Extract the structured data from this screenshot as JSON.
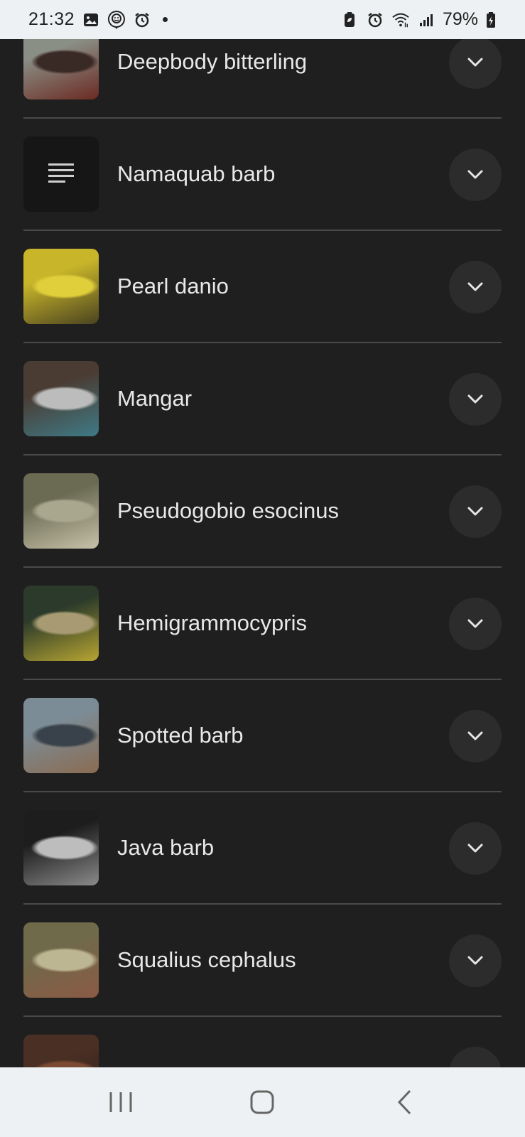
{
  "status_bar": {
    "time": "21:32",
    "battery": "79%",
    "left_icons": [
      "gallery-icon",
      "face-app-icon",
      "alarm-icon"
    ],
    "right_icons": [
      "battery-saver-icon",
      "alarm-icon",
      "wifi-icon",
      "signal-icon",
      "battery-icon"
    ]
  },
  "fish_list": [
    {
      "name": "Deepbody bitterling",
      "thumb": "photo",
      "colors": [
        "#8a8f86",
        "#3a2a26",
        "#6b2a22"
      ]
    },
    {
      "name": "Namaquab barb",
      "thumb": "placeholder",
      "icon": "notes-icon"
    },
    {
      "name": "Pearl danio",
      "thumb": "photo",
      "colors": [
        "#c8b52a",
        "#e0cf3a",
        "#4a4320"
      ]
    },
    {
      "name": "Mangar",
      "thumb": "photo",
      "colors": [
        "#4a3c33",
        "#bcbcbc",
        "#3f7a86"
      ]
    },
    {
      "name": "Pseudogobio esocinus",
      "thumb": "photo",
      "colors": [
        "#6b6b53",
        "#a9a88f",
        "#c7c1a9"
      ]
    },
    {
      "name": "Hemigrammocypris",
      "thumb": "photo",
      "colors": [
        "#2b3a2a",
        "#a89b73",
        "#b7a532"
      ]
    },
    {
      "name": "Spotted barb",
      "thumb": "photo",
      "colors": [
        "#7c8c96",
        "#39424a",
        "#8a6c52"
      ]
    },
    {
      "name": "Java barb",
      "thumb": "photo",
      "colors": [
        "#1d1d1d",
        "#bdbdbd",
        "#8a8a8a"
      ]
    },
    {
      "name": "Squalius cephalus",
      "thumb": "photo",
      "colors": [
        "#6f6a4a",
        "#bdb693",
        "#8a5a45"
      ]
    },
    {
      "name": "",
      "thumb": "photo",
      "colors": [
        "#4a2f24",
        "#7a4a32",
        "#2e1e18"
      ]
    }
  ],
  "nav_bar": {
    "buttons": [
      "recent-apps-button",
      "home-button",
      "back-button"
    ]
  },
  "theme": {
    "background": "#1f1f1f",
    "divider": "#4a4a4a",
    "expand_button_bg": "#2c2c2c",
    "text": "#e8e8e8"
  }
}
